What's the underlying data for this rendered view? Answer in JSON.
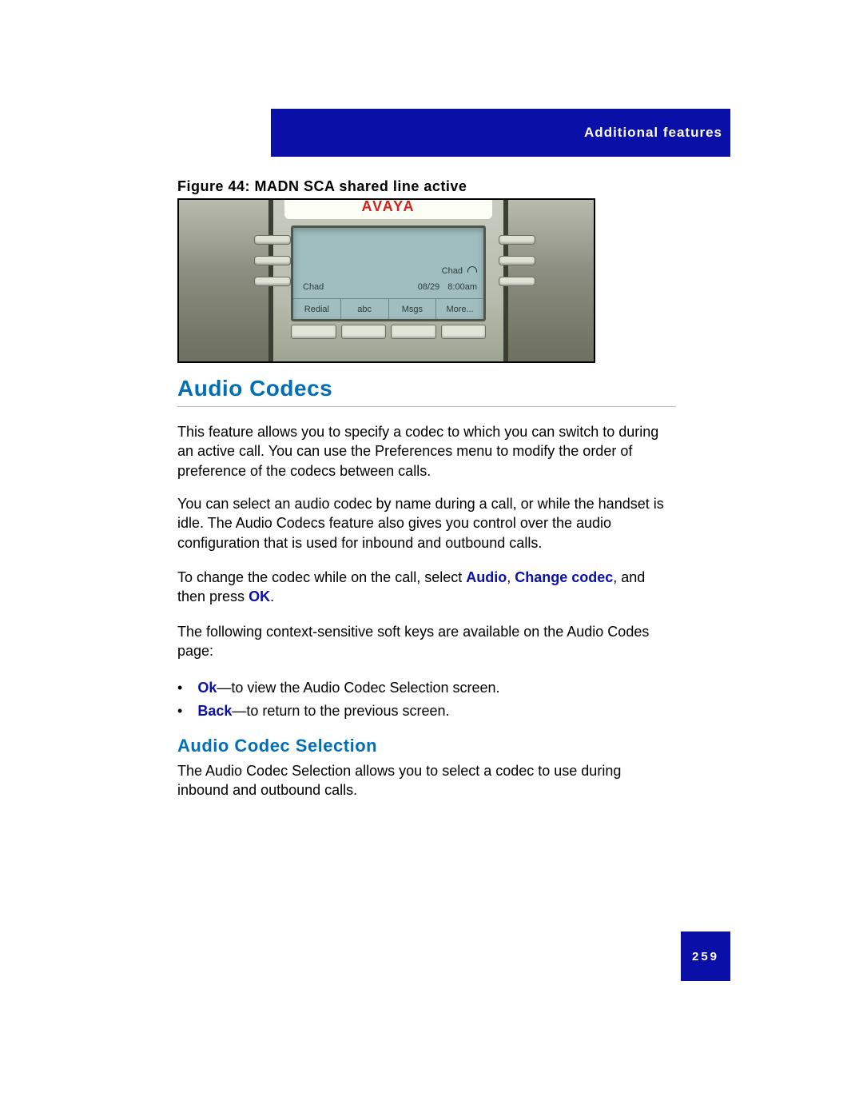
{
  "header": {
    "section_title": "Additional features"
  },
  "figure": {
    "caption": "Figure 44: MADN SCA shared line active",
    "brand": "AVAYA",
    "lcd": {
      "mid_right": "Chad",
      "sub_left": "Chad",
      "sub_date": "08/29",
      "sub_time": "8:00am",
      "softkeys": [
        "Redial",
        "abc",
        "Msgs",
        "More..."
      ]
    }
  },
  "headings": {
    "h1": "Audio Codecs",
    "h2": "Audio Codec Selection"
  },
  "paragraphs": {
    "p1": "This feature allows you to specify a codec to which you can switch to during an active call. You can use the Preferences menu to modify the order of preference of the codecs between calls.",
    "p2": "You can select an audio codec by name during a call, or while the handset is idle. The Audio Codecs feature also gives you control over the audio configuration that is used for inbound and outbound calls.",
    "p3_pre": "To change the codec while on the call, select ",
    "p3_audio": "Audio",
    "p3_sep1": ", ",
    "p3_change": "Change codec",
    "p3_sep2": ", and then press ",
    "p3_ok": "OK",
    "p3_end": ".",
    "p4": "The following context-sensitive soft keys are available on the Audio Codes page:",
    "p5": "The Audio Codec Selection allows you to select a codec to use during inbound and outbound calls."
  },
  "bullets": {
    "b1_key": "Ok",
    "b1_text": "—to view the Audio Codec Selection screen.",
    "b2_key": "Back",
    "b2_text": "—to return to the previous screen."
  },
  "page_number": "259"
}
